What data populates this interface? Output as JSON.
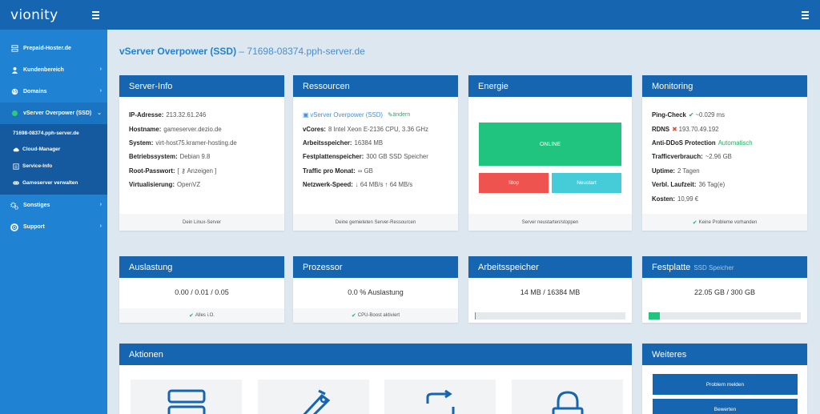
{
  "brand": {
    "logo": "vionity"
  },
  "sidebar": {
    "items": [
      {
        "label": "Prepaid-Hoster.de",
        "icon": "server-icon"
      },
      {
        "label": "Kundenbereich",
        "icon": "user-icon"
      },
      {
        "label": "Domains",
        "icon": "globe-icon"
      },
      {
        "label": "vServer Overpower (SSD)",
        "icon": "status-dot-icon"
      }
    ],
    "sub_title": "71698-08374.pph-server.de",
    "sub_items": [
      {
        "label": "Cloud-Manager",
        "icon": "cloud-icon"
      },
      {
        "label": "Service-Info",
        "icon": "list-icon"
      },
      {
        "label": "Gameserver verwalten",
        "icon": "gamepad-icon"
      }
    ],
    "bottom_items": [
      {
        "label": "Sonstiges",
        "icon": "cogs-icon"
      },
      {
        "label": "Support",
        "icon": "support-icon"
      }
    ]
  },
  "page": {
    "title": "vServer Overpower (SSD)",
    "separator": " – ",
    "host": "71698-08374.pph-server.de"
  },
  "server_info": {
    "title": "Server-Info",
    "rows": [
      {
        "label": "IP-Adresse:",
        "value": "213.32.61.246"
      },
      {
        "label": "Hostname:",
        "value": "gameserver.dezio.de"
      },
      {
        "label": "System:",
        "value": "virt-host75.kramer-hosting.de"
      },
      {
        "label": "Betriebssystem:",
        "value": "Debian 9.8"
      },
      {
        "label": "Root-Passwort:",
        "value": "Anzeigen"
      },
      {
        "label": "Virtualisierung:",
        "value": "OpenVZ"
      }
    ],
    "footer": "Dein Linux-Server"
  },
  "resources": {
    "title": "Ressourcen",
    "product": "vServer Overpower (SSD)",
    "edit": "ändern",
    "rows": [
      {
        "label": "vCores:",
        "value": "8 Intel Xeon E-2136 CPU, 3.36 GHz"
      },
      {
        "label": "Arbeitsspeicher:",
        "value": "16384 MB"
      },
      {
        "label": "Festplattenspeicher:",
        "value": "300 GB SSD Speicher"
      },
      {
        "label": "Traffic pro Monat:",
        "value": "∞ GB"
      },
      {
        "label": "Netzwerk-Speed:",
        "value": "↓ 64 MB/s ↑ 64 MB/s"
      }
    ],
    "footer": "Deine gemieteten Server-Ressourcen"
  },
  "energy": {
    "title": "Energie",
    "status": "ONLINE",
    "stop": "Stop",
    "restart": "Neustart",
    "footer": "Server neustarten/stoppen"
  },
  "monitoring": {
    "title": "Monitoring",
    "ping_label": "Ping-Check",
    "ping_value": "~0.029 ms",
    "rdns_label": "RDNS",
    "rdns_value": "193.70.49.192",
    "ddos_label": "Anti-DDoS Protection",
    "ddos_value": "Automatisch",
    "traffic_label": "Trafficverbrauch:",
    "traffic_value": "~2.96 GB",
    "uptime_label": "Uptime:",
    "uptime_value": "2 Tagen",
    "remaining_label": "Verbl. Laufzeit:",
    "remaining_value": "36 Tag(e)",
    "cost_label": "Kosten:",
    "cost_value": "10,99 €",
    "footer": "Keine Probleme vorhanden"
  },
  "load": {
    "title": "Auslastung",
    "value": "0.00 / 0.01 / 0.05",
    "footer": "Alles i.O."
  },
  "cpu": {
    "title": "Prozessor",
    "value": "0.0 % Auslastung",
    "footer": "CPU-Boost aktiviert"
  },
  "ram": {
    "title": "Arbeitsspeicher",
    "value": "14 MB / 16384 MB",
    "used_fraction": 0.0009
  },
  "disk": {
    "title": "Festplatte",
    "subtitle": "SSD Speicher",
    "value": "22.05 GB / 300 GB",
    "used_fraction": 0.0735
  },
  "actions": {
    "title": "Aktionen",
    "tiles": [
      "server-stack-icon",
      "tag-icon",
      "transfer-icon",
      "lock-icon"
    ]
  },
  "more": {
    "title": "Weiteres",
    "report": "Problem melden",
    "rate": "Bewerten"
  },
  "colors": {
    "primary": "#1565b1",
    "sidebar": "#1f82d2",
    "online": "#21c47e",
    "stop": "#ee5350",
    "restart": "#46ccd8"
  }
}
